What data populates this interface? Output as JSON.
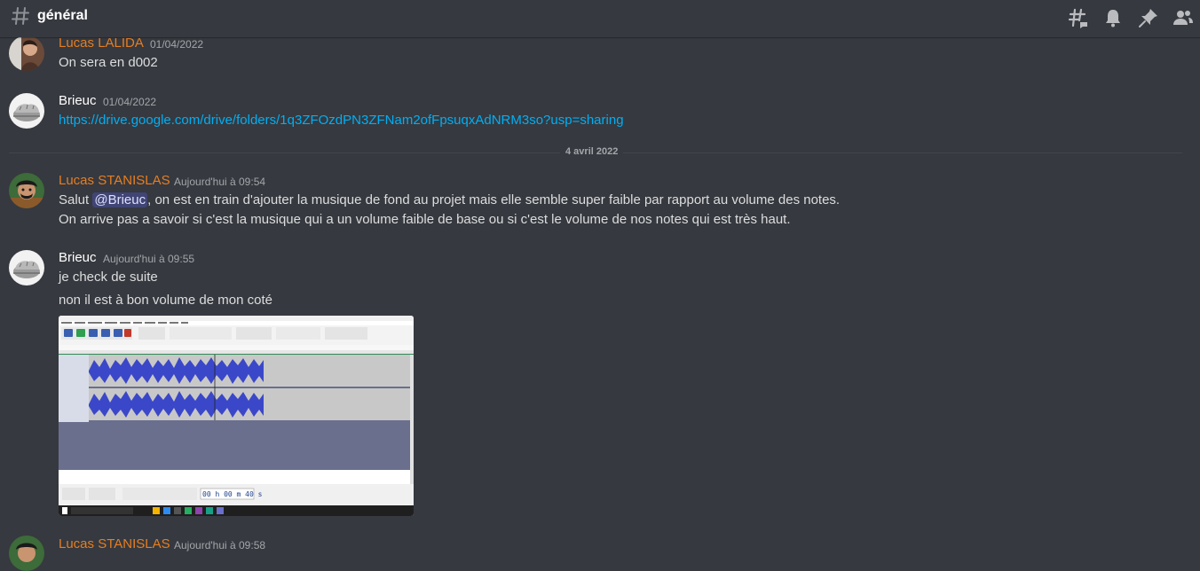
{
  "channel": {
    "name": "général"
  },
  "header_icons": [
    "threads-icon",
    "bell-icon",
    "pin-icon",
    "members-icon"
  ],
  "colors": {
    "orange_user": "#e67e22",
    "white_user": "#ffffff",
    "link": "#00aff4",
    "background": "#36393f"
  },
  "messages": [
    {
      "author": "Lucas LALIDA",
      "timestamp": "01/04/2022",
      "text": "On sera en d002"
    },
    {
      "author": "Brieuc",
      "timestamp": "01/04/2022",
      "link": "https://drive.google.com/drive/folders/1q3ZFOzdPN3ZFNam2ofFpsuqxAdNRM3so?usp=sharing"
    },
    {
      "author": "Lucas STANISLAS",
      "timestamp": "Aujourd'hui à 09:54",
      "line1_prefix": "Salut ",
      "mention": "@Brieuc",
      "line1_suffix": ", on est en train d'ajouter la musique de fond au projet mais elle semble super faible par rapport au volume des notes.",
      "line2": "On arrive pas a savoir si c'est la musique qui a un volume faible de base ou si c'est le volume de nos notes qui est très haut."
    },
    {
      "author": "Brieuc",
      "timestamp": "Aujourd'hui à 09:55",
      "line1": "je check de suite",
      "line2": "non il est à bon volume de mon coté",
      "attachment": {
        "type": "image",
        "description": "audacity-screenshot",
        "timecode": "00 h 00 m 40 s"
      }
    },
    {
      "author": "Lucas STANISLAS",
      "timestamp": "Aujourd'hui à 09:58"
    }
  ],
  "date_divider": "4 avril 2022"
}
